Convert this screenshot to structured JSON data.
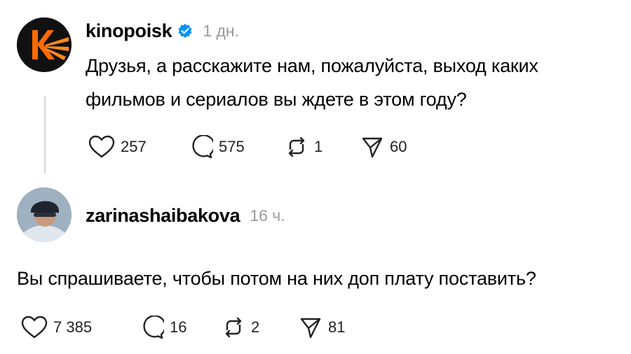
{
  "post": {
    "username": "kinopoisk",
    "verified_icon": "verified-badge-icon",
    "time": "1 дн.",
    "text_line1": "Друзья, а расскажите нам, пожалуйста, выход каких",
    "text_line2": "фильмов и сериалов вы ждете в этом году?",
    "likes": "257",
    "replies": "575",
    "reposts": "1",
    "shares": "60",
    "avatar_colors": {
      "bg": "#111111",
      "accent": "#ff6a00"
    }
  },
  "reply": {
    "username": "zarinashaibakova",
    "time": "16 ч.",
    "text": "Вы спрашиваете, чтобы потом на них доп плату поставить?",
    "likes": "7 385",
    "replies": "16",
    "reposts": "2",
    "shares": "81"
  },
  "colors": {
    "verified": "#0095f6",
    "muted": "#9a9a9a",
    "line": "#d4d4d4"
  }
}
